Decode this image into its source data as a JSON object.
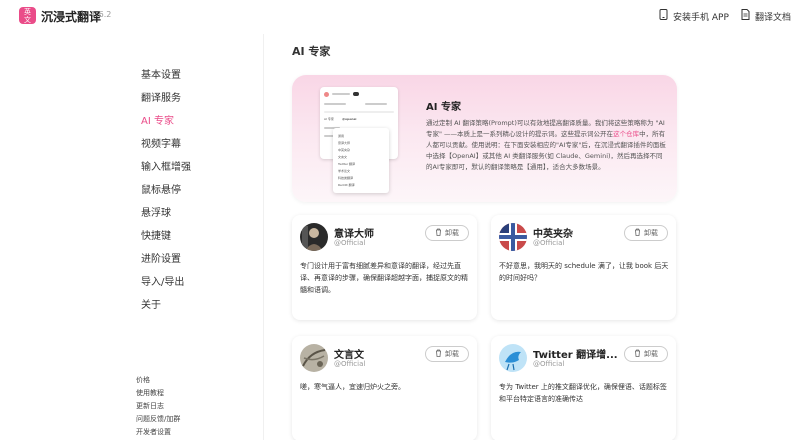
{
  "header": {
    "logo_text": "英\n文",
    "app_name": "沉浸式翻译",
    "version": "1.6.2",
    "install_app": "安装手机 APP",
    "docs": "翻译文档"
  },
  "sidebar": {
    "items": [
      {
        "label": "基本设置",
        "active": false
      },
      {
        "label": "翻译服务",
        "active": false
      },
      {
        "label": "AI 专家",
        "active": true
      },
      {
        "label": "视频字幕",
        "active": false
      },
      {
        "label": "输入框增强",
        "active": false
      },
      {
        "label": "鼠标悬停",
        "active": false
      },
      {
        "label": "悬浮球",
        "active": false
      },
      {
        "label": "快捷键",
        "active": false
      },
      {
        "label": "进阶设置",
        "active": false
      },
      {
        "label": "导入/导出",
        "active": false
      },
      {
        "label": "关于",
        "active": false
      }
    ],
    "footer": [
      "价格",
      "使用教程",
      "更新日志",
      "问题反馈/加群",
      "开发者设置"
    ]
  },
  "main": {
    "title": "AI 专家",
    "hero": {
      "title": "AI 专家",
      "desc_before": "通过定制 AI 翻译策略(Prompt)可以有效地提高翻译质量。我们将这些策略称为 \"AI专家\" ——本质上是一系列精心设计的提示词。这些提示词公开在",
      "desc_link": "这个仓库",
      "desc_after": "中，所有人都可以贡献。使用说明：在下面安装相应的\"AI专家\"后，在沉浸式翻译插件的面板中选择【OpenAI】或其他 AI 类翻译服务(如 Claude、Gemini)，然后再选择不同的AI专家即可，默认的翻译策略是【通用】，适合大多数场景。",
      "mock_dropdown_label": "AI 专家",
      "mock_dropdown_value": "@openai",
      "mock_options": [
        "通用",
        "意译大师",
        "中英夹杂",
        "文言文",
        "Twitter 翻译",
        "学术论文",
        "科技类翻译",
        "Reddit 翻译"
      ]
    },
    "cards": [
      {
        "name": "意译大师",
        "author": "@Official",
        "button": "卸载",
        "desc": "专门设计用于富有细腻差异和意译的翻译，经过先直译、再意译的步骤，确保翻译超越字面，捕捉原文的精髓和语调。"
      },
      {
        "name": "中英夹杂",
        "author": "@Official",
        "button": "卸载",
        "desc": "不好意思，我明天的 schedule 满了，让我 book 后天的时间好吗？"
      },
      {
        "name": "文言文",
        "author": "@Official",
        "button": "卸载",
        "desc": "嗟，寒气逼人，宜速归炉火之旁。"
      },
      {
        "name": "Twitter 翻译增...",
        "author": "@Official",
        "button": "卸载",
        "desc": "专为 Twitter 上的推文翻译优化，确保俚语、话题标签和平台特定语言的准确传达"
      }
    ]
  },
  "colors": {
    "accent": "#ea4c89",
    "hero_top": "#f9d6e6"
  }
}
